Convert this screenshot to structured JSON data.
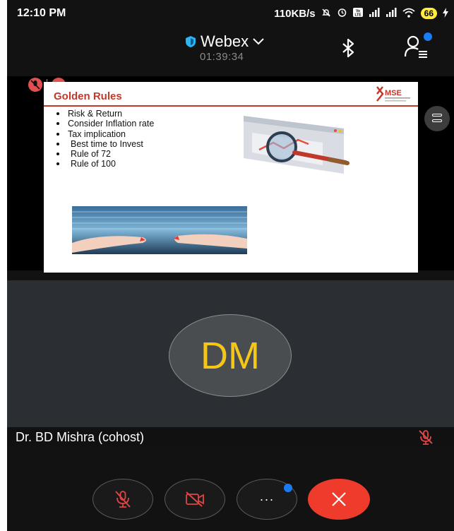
{
  "status_bar": {
    "time": "12:10 PM",
    "network_speed": "110KB/s",
    "battery": "66",
    "icons": [
      "mute-notification-icon",
      "alarm-icon",
      "volte-icon",
      "signal-icon",
      "signal-icon",
      "wifi-icon",
      "battery-icon",
      "charging-icon"
    ]
  },
  "header": {
    "title": "Webex",
    "timer": "01:39:34",
    "icons": [
      "shield-icon",
      "chevron-down-icon",
      "bluetooth-icon",
      "participants-icon"
    ]
  },
  "shared_content": {
    "slide_title": "Golden Rules",
    "logo_text": "XMSE",
    "bullets": [
      "Risk & Return",
      "Consider Inflation rate",
      "Tax implication",
      "Best time to Invest",
      "Rule of 72",
      "Rule of 100"
    ]
  },
  "participant": {
    "initials": "DM",
    "name": "Dr. BD Mishra (cohost)"
  },
  "colors": {
    "end_call": "#ee3b2b",
    "avatar_text": "#f5c518",
    "accent_blue": "#1a7cf5",
    "slide_title": "#c0392b"
  },
  "controls": {
    "more_label": "···",
    "icons": [
      "mic-muted-icon",
      "video-off-icon",
      "more-icon",
      "end-call-icon"
    ]
  }
}
